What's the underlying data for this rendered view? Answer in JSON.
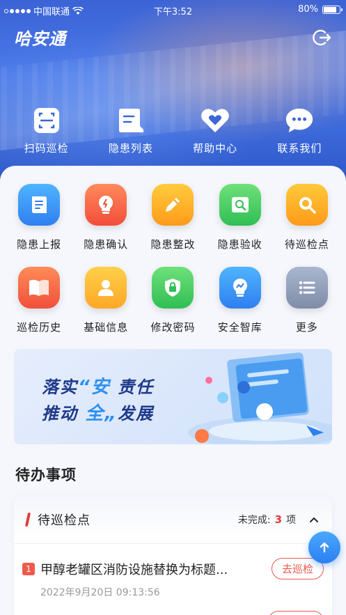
{
  "status_bar": {
    "carrier": "中国联通",
    "time": "下午3:52",
    "battery": "80%",
    "battery_level": 0.8
  },
  "header": {
    "app_title": "哈安通"
  },
  "quick_actions": [
    {
      "label": "扫码巡检",
      "icon": "scan-icon"
    },
    {
      "label": "隐患列表",
      "icon": "list-icon"
    },
    {
      "label": "帮助中心",
      "icon": "heart-icon"
    },
    {
      "label": "联系我们",
      "icon": "chat-icon"
    }
  ],
  "grid_items": [
    {
      "label": "隐患上报",
      "icon": "report-icon",
      "color_from": "#4fb4ff",
      "color_to": "#2f7ff0"
    },
    {
      "label": "隐患确认",
      "icon": "bulb-alert-icon",
      "color_from": "#ff8a5c",
      "color_to": "#f24d3a"
    },
    {
      "label": "隐患整改",
      "icon": "pencil-icon",
      "color_from": "#ffcb3d",
      "color_to": "#ff9b1a"
    },
    {
      "label": "隐患验收",
      "icon": "inspect-icon",
      "color_from": "#6fe07a",
      "color_to": "#2fbf54"
    },
    {
      "label": "待巡检点",
      "icon": "search-icon",
      "color_from": "#ffc93a",
      "color_to": "#ff9a1a"
    },
    {
      "label": "巡检历史",
      "icon": "book-icon",
      "color_from": "#ff8c5a",
      "color_to": "#f0503a"
    },
    {
      "label": "基础信息",
      "icon": "person-icon",
      "color_from": "#ffd04a",
      "color_to": "#ffa726"
    },
    {
      "label": "修改密码",
      "icon": "shield-lock-icon",
      "color_from": "#6fe07a",
      "color_to": "#2fbf54"
    },
    {
      "label": "安全智库",
      "icon": "bulb-icon",
      "color_from": "#4fb4ff",
      "color_to": "#2f7ff0"
    },
    {
      "label": "更多",
      "icon": "more-list-icon",
      "color_from": "#a9b6cf",
      "color_to": "#7f8ca8"
    }
  ],
  "banner": {
    "line1_prefix": "落实",
    "line1_quote_open": "“",
    "line1_highlight": "安",
    "line1_suffix": "责任",
    "line2_prefix": "推动",
    "line2_highlight": "全",
    "line2_quote_close": "„",
    "line2_suffix": "发展"
  },
  "todo": {
    "section_title": "待办事项",
    "card_title": "待巡检点",
    "status_prefix": "未完成:",
    "count": "3",
    "status_suffix": "项",
    "tasks": [
      {
        "index": "1",
        "title": "甲醇老罐区消防设施替换为标题...",
        "time": "2022年9月20日 09:13:56",
        "action": "去巡检"
      }
    ]
  },
  "colors": {
    "accent": "#2f7ff0",
    "danger": "#e23b3b"
  }
}
